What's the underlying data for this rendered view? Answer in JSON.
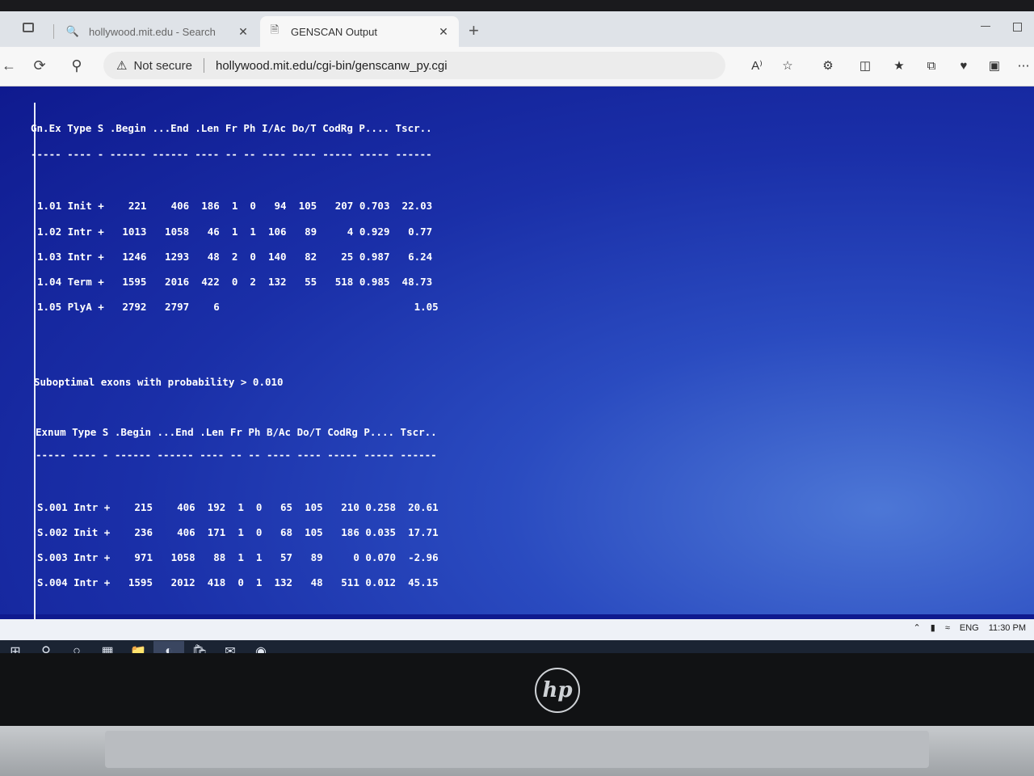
{
  "browser": {
    "tabs": [
      {
        "title": "hollywood.mit.edu - Search",
        "active": false,
        "icon": "search-icon"
      },
      {
        "title": "GENSCAN Output",
        "active": true,
        "icon": "page-icon"
      }
    ],
    "new_tab_label": "+",
    "security": "Not secure",
    "url": "hollywood.mit.edu/cgi-bin/genscanw_py.cgi",
    "read_aloud_label": "A⁾"
  },
  "genscan": {
    "header": "Gn.Ex Type S .Begin ...End .Len Fr Ph I/Ac Do/T CodRg P.... Tscr..",
    "underline": "----- ---- - ------ ------ ---- -- -- ---- ---- ----- ----- ------",
    "rows": [
      "1.01 Init +    221    406  186  1  0   94  105   207 0.703  22.03",
      "1.02 Intr +   1013   1058   46  1  1  106   89     4 0.929   0.77",
      "1.03 Intr +   1246   1293   48  2  0  140   82    25 0.987   6.24",
      "1.04 Term +   1595   2016  422  0  2  132   55   518 0.985  48.73",
      "1.05 PlyA +   2792   2797    6                                1.05"
    ],
    "suboptimal_title": "Suboptimal exons with probability > 0.010",
    "sub_header": "Exnum Type S .Begin ...End .Len Fr Ph B/Ac Do/T CodRg P.... Tscr..",
    "sub_underline": "----- ---- - ------ ------ ---- -- -- ---- ---- ----- ----- ------",
    "sub_rows": [
      "S.001 Intr +    215    406  192  1  0   65  105   210 0.258  20.61",
      "S.002 Init +    236    406  171  1  0   68  105   186 0.035  17.71",
      "S.003 Intr +    971   1058   88  1  1   57   89     0 0.070  -2.96",
      "S.004 Intr +   1595   2012  418  0  1  132   48   511 0.012  45.15"
    ]
  },
  "system": {
    "language": "ENG",
    "time": "11:30 PM"
  },
  "laptop": {
    "brand": "hp"
  }
}
